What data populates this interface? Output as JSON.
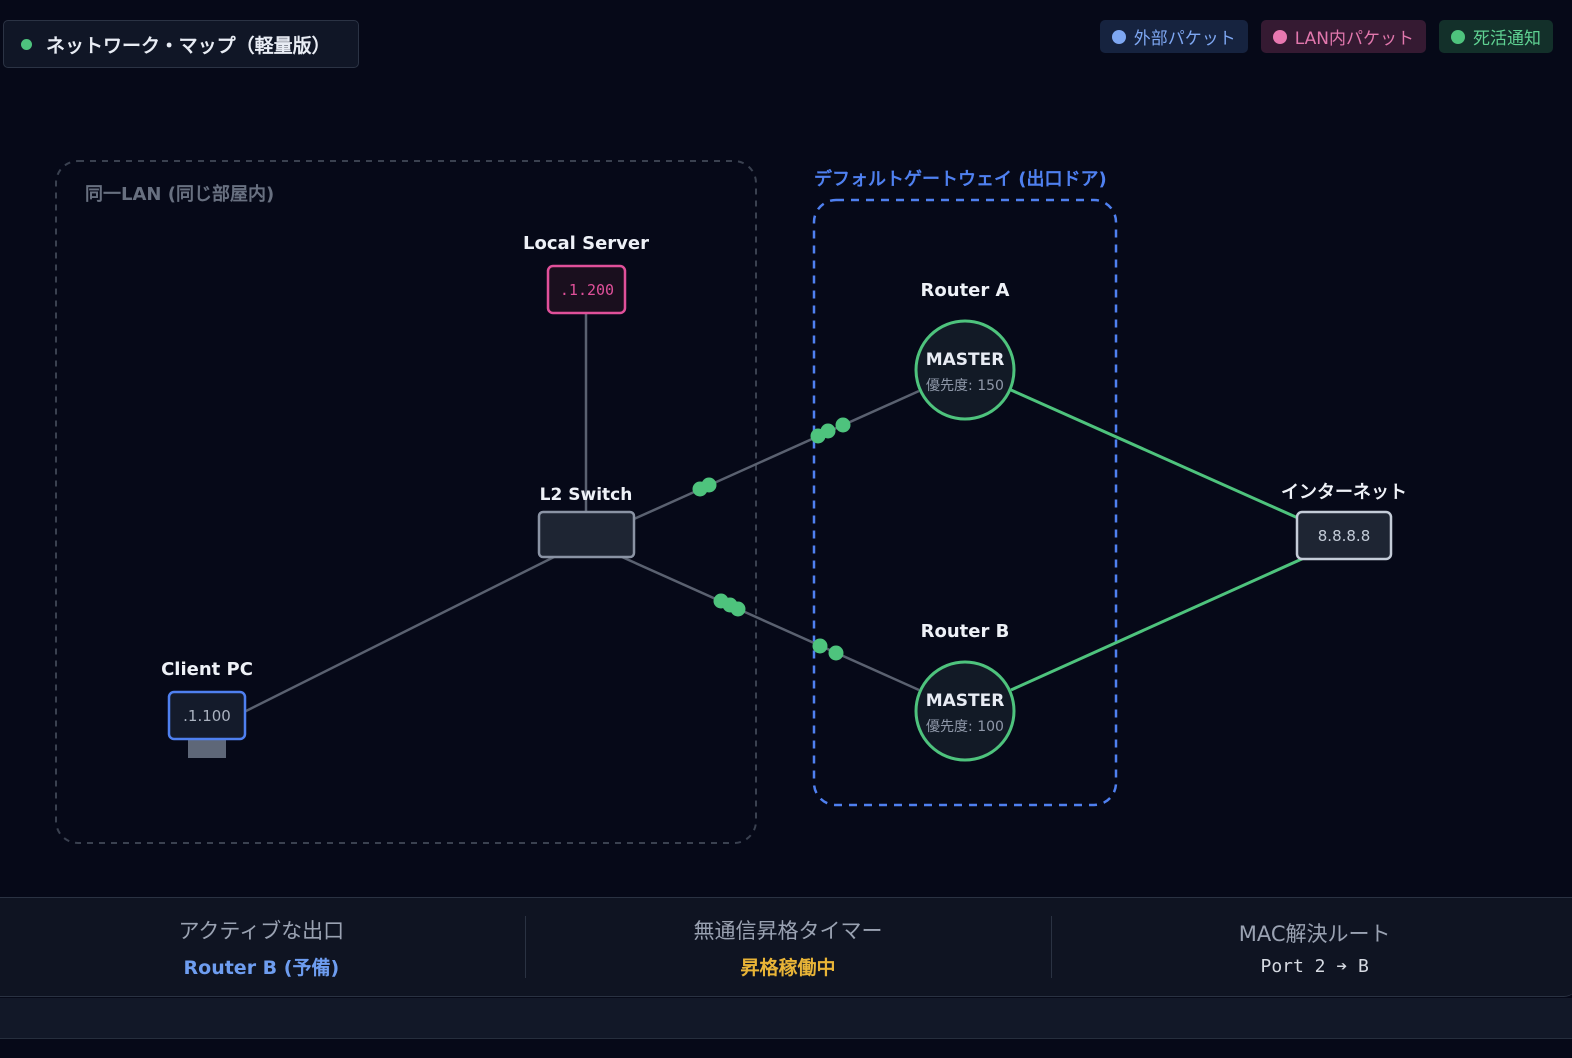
{
  "header": {
    "title": "ネットワーク・マップ（軽量版）"
  },
  "legend": {
    "external": "外部パケット",
    "lan": "LAN内パケット",
    "heartbeat": "死活通知"
  },
  "colors": {
    "external": "#7ea7f2",
    "lan": "#e878b0",
    "heartbeat": "#4ec37d",
    "link": "#5a6170",
    "active_link": "#4ec37d",
    "gateway_zone": "#4f80f0",
    "lan_zone": "#3a4150"
  },
  "zones": {
    "lan": "同一LAN (同じ部屋内)",
    "gateway": "デフォルトゲートウェイ (出口ドア)"
  },
  "nodes": {
    "local_server": {
      "label": "Local Server",
      "ip": ".1.200"
    },
    "switch": {
      "label": "L2 Switch"
    },
    "client": {
      "label": "Client PC",
      "ip": ".1.100"
    },
    "router_a": {
      "label": "Router A",
      "state": "MASTER",
      "priority": "優先度: 150"
    },
    "router_b": {
      "label": "Router B",
      "state": "MASTER",
      "priority": "優先度: 100"
    },
    "internet": {
      "label": "インターネット",
      "ip": "8.8.8.8"
    }
  },
  "status": {
    "active_exit": {
      "title": "アクティブな出口",
      "value": "Router B (予備)"
    },
    "timer": {
      "title": "無通信昇格タイマー",
      "value": "昇格稼働中"
    },
    "mac_route": {
      "title": "MAC解決ルート",
      "value": "Port 2 ➔ B"
    }
  }
}
